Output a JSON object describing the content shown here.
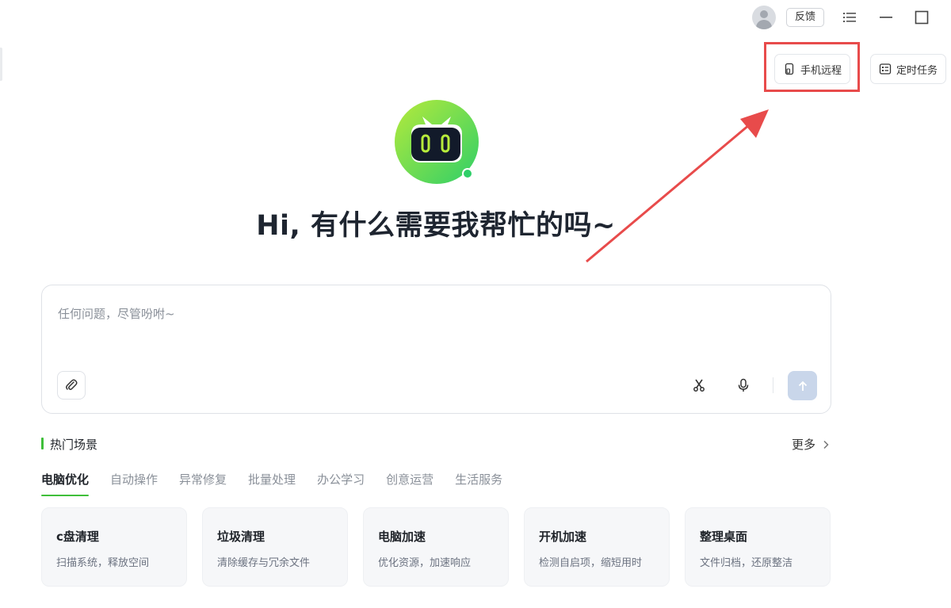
{
  "titlebar": {
    "feedback_label": "反馈"
  },
  "top_actions": {
    "remote_label": "手机远程",
    "task_label": "定时任务"
  },
  "greeting": "Hi, 有什么需要我帮忙的吗~",
  "input": {
    "placeholder": "任何问题，尽管吩咐~"
  },
  "section": {
    "title": "热门场景",
    "more_label": "更多"
  },
  "tabs": [
    {
      "label": "电脑优化",
      "active": true
    },
    {
      "label": "自动操作"
    },
    {
      "label": "异常修复"
    },
    {
      "label": "批量处理"
    },
    {
      "label": "办公学习"
    },
    {
      "label": "创意运营"
    },
    {
      "label": "生活服务"
    }
  ],
  "cards": [
    {
      "title": "c盘清理",
      "desc": "扫描系统，释放空间"
    },
    {
      "title": "垃圾清理",
      "desc": "清除缓存与冗余文件"
    },
    {
      "title": "电脑加速",
      "desc": "优化资源，加速响应"
    },
    {
      "title": "开机加速",
      "desc": "检测自启项，缩短用时"
    },
    {
      "title": "整理桌面",
      "desc": "文件归档，还原整洁"
    }
  ],
  "colors": {
    "accent_green": "#3fbf3a",
    "annotation_red": "#e84b4b",
    "send_button": "#c9d6ea"
  }
}
